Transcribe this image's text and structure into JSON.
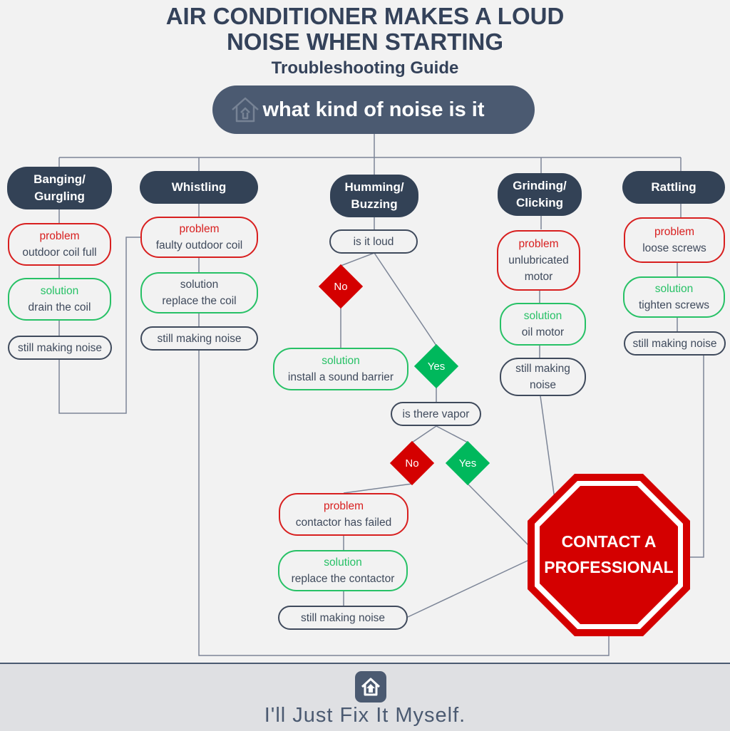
{
  "header": {
    "title_line1": "AIR CONDITIONER MAKES A LOUD",
    "title_line2": "NOISE WHEN STARTING",
    "subtitle": "Troubleshooting Guide"
  },
  "root_question": {
    "icon": "house-icon",
    "text": "what kind of noise is it"
  },
  "colors": {
    "dark": "#334256",
    "root": "#4b5a71",
    "problem": "#d81f1f",
    "solution": "#27c166",
    "no": "#d40000",
    "yes": "#00b85c",
    "stop": "#d40000"
  },
  "branches": [
    {
      "label": "Banging/ Gurgling",
      "problem_label": "problem",
      "problem": "outdoor coil full",
      "solution_label": "solution",
      "solution": "drain the coil",
      "followup": "still making noise"
    },
    {
      "label": "Whistling",
      "problem_label": "problem",
      "problem": "faulty outdoor coil",
      "solution_label": "solution",
      "solution": "replace the coil",
      "followup": "still making noise"
    },
    {
      "label": "Humming/ Buzzing",
      "question1": "is it loud",
      "q1_no": "No",
      "q1_no_solution_label": "solution",
      "q1_no_solution": "install a sound barrier",
      "q1_yes": "Yes",
      "question2": "is there vapor",
      "q2_no": "No",
      "q2_yes": "Yes",
      "problem_label": "problem",
      "problem": "contactor has failed",
      "solution_label": "solution",
      "solution": "replace the contactor",
      "followup": "still making noise"
    },
    {
      "label": "Grinding/ Clicking",
      "problem_label": "problem",
      "problem": "unlubricated motor",
      "solution_label": "solution",
      "solution": "oil motor",
      "followup": "still making noise"
    },
    {
      "label": "Rattling",
      "problem_label": "problem",
      "problem": "loose screws",
      "solution_label": "solution",
      "solution": "tighten screws",
      "followup": "still making noise"
    }
  ],
  "terminal": {
    "line1": "CONTACT A",
    "line2": "PROFESSIONAL",
    "icon": "stop-sign-icon"
  },
  "footer": {
    "logo_icon": "house-logo-icon",
    "brand": "I'll Just Fix It Myself."
  }
}
